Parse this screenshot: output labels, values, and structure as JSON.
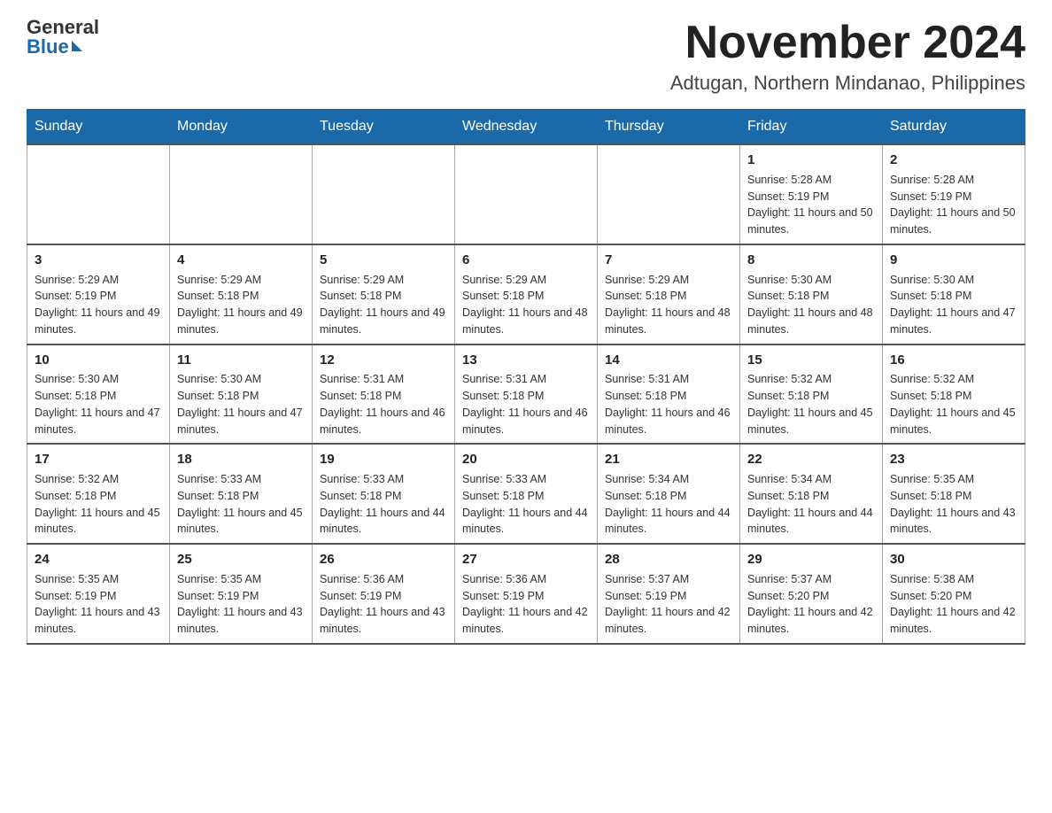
{
  "header": {
    "logo_general": "General",
    "logo_blue": "Blue",
    "month_title": "November 2024",
    "location": "Adtugan, Northern Mindanao, Philippines"
  },
  "calendar": {
    "days_of_week": [
      "Sunday",
      "Monday",
      "Tuesday",
      "Wednesday",
      "Thursday",
      "Friday",
      "Saturday"
    ],
    "weeks": [
      [
        {
          "day": "",
          "info": ""
        },
        {
          "day": "",
          "info": ""
        },
        {
          "day": "",
          "info": ""
        },
        {
          "day": "",
          "info": ""
        },
        {
          "day": "",
          "info": ""
        },
        {
          "day": "1",
          "info": "Sunrise: 5:28 AM\nSunset: 5:19 PM\nDaylight: 11 hours and 50 minutes."
        },
        {
          "day": "2",
          "info": "Sunrise: 5:28 AM\nSunset: 5:19 PM\nDaylight: 11 hours and 50 minutes."
        }
      ],
      [
        {
          "day": "3",
          "info": "Sunrise: 5:29 AM\nSunset: 5:19 PM\nDaylight: 11 hours and 49 minutes."
        },
        {
          "day": "4",
          "info": "Sunrise: 5:29 AM\nSunset: 5:18 PM\nDaylight: 11 hours and 49 minutes."
        },
        {
          "day": "5",
          "info": "Sunrise: 5:29 AM\nSunset: 5:18 PM\nDaylight: 11 hours and 49 minutes."
        },
        {
          "day": "6",
          "info": "Sunrise: 5:29 AM\nSunset: 5:18 PM\nDaylight: 11 hours and 48 minutes."
        },
        {
          "day": "7",
          "info": "Sunrise: 5:29 AM\nSunset: 5:18 PM\nDaylight: 11 hours and 48 minutes."
        },
        {
          "day": "8",
          "info": "Sunrise: 5:30 AM\nSunset: 5:18 PM\nDaylight: 11 hours and 48 minutes."
        },
        {
          "day": "9",
          "info": "Sunrise: 5:30 AM\nSunset: 5:18 PM\nDaylight: 11 hours and 47 minutes."
        }
      ],
      [
        {
          "day": "10",
          "info": "Sunrise: 5:30 AM\nSunset: 5:18 PM\nDaylight: 11 hours and 47 minutes."
        },
        {
          "day": "11",
          "info": "Sunrise: 5:30 AM\nSunset: 5:18 PM\nDaylight: 11 hours and 47 minutes."
        },
        {
          "day": "12",
          "info": "Sunrise: 5:31 AM\nSunset: 5:18 PM\nDaylight: 11 hours and 46 minutes."
        },
        {
          "day": "13",
          "info": "Sunrise: 5:31 AM\nSunset: 5:18 PM\nDaylight: 11 hours and 46 minutes."
        },
        {
          "day": "14",
          "info": "Sunrise: 5:31 AM\nSunset: 5:18 PM\nDaylight: 11 hours and 46 minutes."
        },
        {
          "day": "15",
          "info": "Sunrise: 5:32 AM\nSunset: 5:18 PM\nDaylight: 11 hours and 45 minutes."
        },
        {
          "day": "16",
          "info": "Sunrise: 5:32 AM\nSunset: 5:18 PM\nDaylight: 11 hours and 45 minutes."
        }
      ],
      [
        {
          "day": "17",
          "info": "Sunrise: 5:32 AM\nSunset: 5:18 PM\nDaylight: 11 hours and 45 minutes."
        },
        {
          "day": "18",
          "info": "Sunrise: 5:33 AM\nSunset: 5:18 PM\nDaylight: 11 hours and 45 minutes."
        },
        {
          "day": "19",
          "info": "Sunrise: 5:33 AM\nSunset: 5:18 PM\nDaylight: 11 hours and 44 minutes."
        },
        {
          "day": "20",
          "info": "Sunrise: 5:33 AM\nSunset: 5:18 PM\nDaylight: 11 hours and 44 minutes."
        },
        {
          "day": "21",
          "info": "Sunrise: 5:34 AM\nSunset: 5:18 PM\nDaylight: 11 hours and 44 minutes."
        },
        {
          "day": "22",
          "info": "Sunrise: 5:34 AM\nSunset: 5:18 PM\nDaylight: 11 hours and 44 minutes."
        },
        {
          "day": "23",
          "info": "Sunrise: 5:35 AM\nSunset: 5:18 PM\nDaylight: 11 hours and 43 minutes."
        }
      ],
      [
        {
          "day": "24",
          "info": "Sunrise: 5:35 AM\nSunset: 5:19 PM\nDaylight: 11 hours and 43 minutes."
        },
        {
          "day": "25",
          "info": "Sunrise: 5:35 AM\nSunset: 5:19 PM\nDaylight: 11 hours and 43 minutes."
        },
        {
          "day": "26",
          "info": "Sunrise: 5:36 AM\nSunset: 5:19 PM\nDaylight: 11 hours and 43 minutes."
        },
        {
          "day": "27",
          "info": "Sunrise: 5:36 AM\nSunset: 5:19 PM\nDaylight: 11 hours and 42 minutes."
        },
        {
          "day": "28",
          "info": "Sunrise: 5:37 AM\nSunset: 5:19 PM\nDaylight: 11 hours and 42 minutes."
        },
        {
          "day": "29",
          "info": "Sunrise: 5:37 AM\nSunset: 5:20 PM\nDaylight: 11 hours and 42 minutes."
        },
        {
          "day": "30",
          "info": "Sunrise: 5:38 AM\nSunset: 5:20 PM\nDaylight: 11 hours and 42 minutes."
        }
      ]
    ]
  }
}
